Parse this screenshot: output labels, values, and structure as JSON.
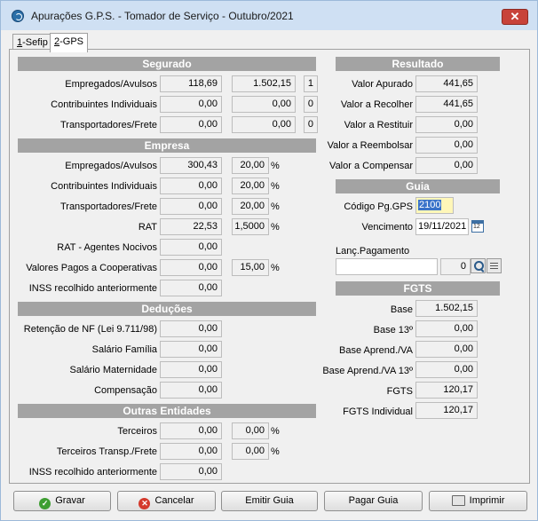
{
  "window": {
    "title": "Apurações G.P.S. - Tomador de Serviço - Outubro/2021",
    "close_label": "✕"
  },
  "tabs": [
    {
      "label_underlined": "1",
      "label_rest": "-Sefip"
    },
    {
      "label_underlined": "2",
      "label_rest": "-GPS"
    }
  ],
  "segurado": {
    "title": "Segurado",
    "rows": [
      {
        "label": "Empregados/Avulsos",
        "v1": "118,69",
        "v2": "1.502,15",
        "v3": "1"
      },
      {
        "label": "Contribuintes Individuais",
        "v1": "0,00",
        "v2": "0,00",
        "v3": "0"
      },
      {
        "label": "Transportadores/Frete",
        "v1": "0,00",
        "v2": "0,00",
        "v3": "0"
      }
    ]
  },
  "empresa": {
    "title": "Empresa",
    "rows": [
      {
        "label": "Empregados/Avulsos",
        "v1": "300,43",
        "v2": "20,00",
        "unit": "%"
      },
      {
        "label": "Contribuintes Individuais",
        "v1": "0,00",
        "v2": "20,00",
        "unit": "%"
      },
      {
        "label": "Transportadores/Frete",
        "v1": "0,00",
        "v2": "20,00",
        "unit": "%"
      },
      {
        "label": "RAT",
        "v1": "22,53",
        "v2": "1,5000",
        "unit": "%"
      },
      {
        "label": "RAT - Agentes Nocivos",
        "v1": "0,00"
      },
      {
        "label": "Valores Pagos a Cooperativas",
        "v1": "0,00",
        "v2": "15,00",
        "unit": "%"
      },
      {
        "label": "INSS recolhido anteriormente",
        "v1": "0,00"
      }
    ]
  },
  "deducoes": {
    "title": "Deduções",
    "rows": [
      {
        "label": "Retenção de NF (Lei 9.711/98)",
        "v1": "0,00"
      },
      {
        "label": "Salário Família",
        "v1": "0,00"
      },
      {
        "label": "Salário Maternidade",
        "v1": "0,00"
      },
      {
        "label": "Compensação",
        "v1": "0,00"
      }
    ]
  },
  "outras": {
    "title": "Outras Entidades",
    "rows": [
      {
        "label": "Terceiros",
        "v1": "0,00",
        "v2": "0,00",
        "unit": "%"
      },
      {
        "label": "Terceiros Transp./Frete",
        "v1": "0,00",
        "v2": "0,00",
        "unit": "%"
      },
      {
        "label": "INSS recolhido anteriormente",
        "v1": "0,00"
      }
    ]
  },
  "resultado": {
    "title": "Resultado",
    "rows": [
      {
        "label": "Valor Apurado",
        "v": "441,65"
      },
      {
        "label": "Valor a Recolher",
        "v": "441,65"
      },
      {
        "label": "Valor a Restituir",
        "v": "0,00"
      },
      {
        "label": "Valor a Reembolsar",
        "v": "0,00"
      },
      {
        "label": "Valor a Compensar",
        "v": "0,00"
      }
    ]
  },
  "guia": {
    "title": "Guia",
    "codigo_label": "Código Pg.GPS",
    "codigo_value": "2100",
    "vencimento_label": "Vencimento",
    "vencimento_value": "19/11/2021",
    "calendar_text": "12",
    "lanc_label": "Lanç.Pagamento",
    "lanc_value": "",
    "lanc_number": "0"
  },
  "fgts": {
    "title": "FGTS",
    "rows": [
      {
        "label": "Base",
        "v": "1.502,15"
      },
      {
        "label": "Base 13º",
        "v": "0,00"
      },
      {
        "label": "Base Aprend./VA",
        "v": "0,00"
      },
      {
        "label": "Base Aprend./VA 13º",
        "v": "0,00"
      },
      {
        "label": "FGTS",
        "v": "120,17"
      },
      {
        "label": "FGTS Individual",
        "v": "120,17"
      }
    ]
  },
  "buttons": {
    "gravar": "Gravar",
    "cancelar": "Cancelar",
    "emitir": "Emitir Guia",
    "pagar": "Pagar Guia",
    "imprimir": "Imprimir"
  }
}
